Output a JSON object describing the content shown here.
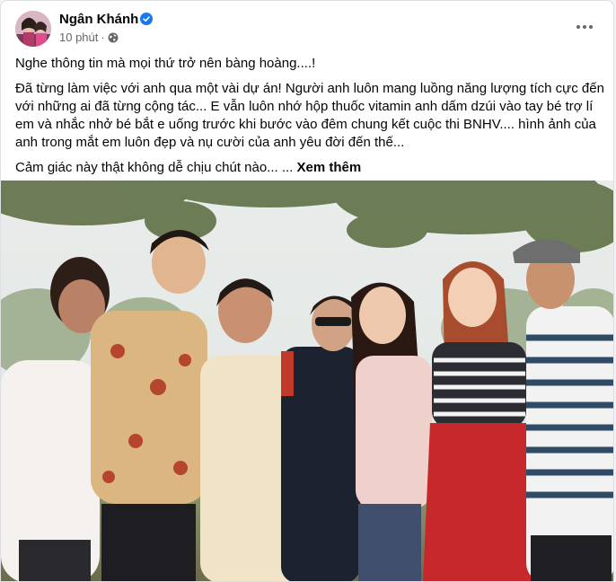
{
  "post": {
    "author": "Ngân Khánh",
    "timestamp": "10 phút",
    "separator": "·",
    "privacy_icon": "globe-icon",
    "more_icon": "more-horizontal-icon",
    "verified_icon": "verified-badge-icon",
    "paragraphs": [
      "Nghe thông tin mà mọi thứ trở nên bàng hoàng....!",
      "Đã từng làm việc với anh qua một vài dự án! Người anh luôn mang luồng năng lượng tích cực đến với những ai đã từng cộng tác... E vẫn luôn nhớ hộp thuốc vitamin anh dấm dzúi vào tay bé trợ lí em và nhắc nhở bé bắt e uống trước khi bước vào đêm chung kết cuộc thi BNHV.... hình ảnh của anh trong mắt em luôn đẹp và nụ cười của anh yêu đời đến thế..."
    ],
    "last_line": "Cảm giác này thật không dễ chịu chút nào... ...",
    "see_more": "Xem thêm",
    "colors": {
      "verified": "#1877f2",
      "text": "#050505",
      "meta": "#65676b"
    }
  }
}
